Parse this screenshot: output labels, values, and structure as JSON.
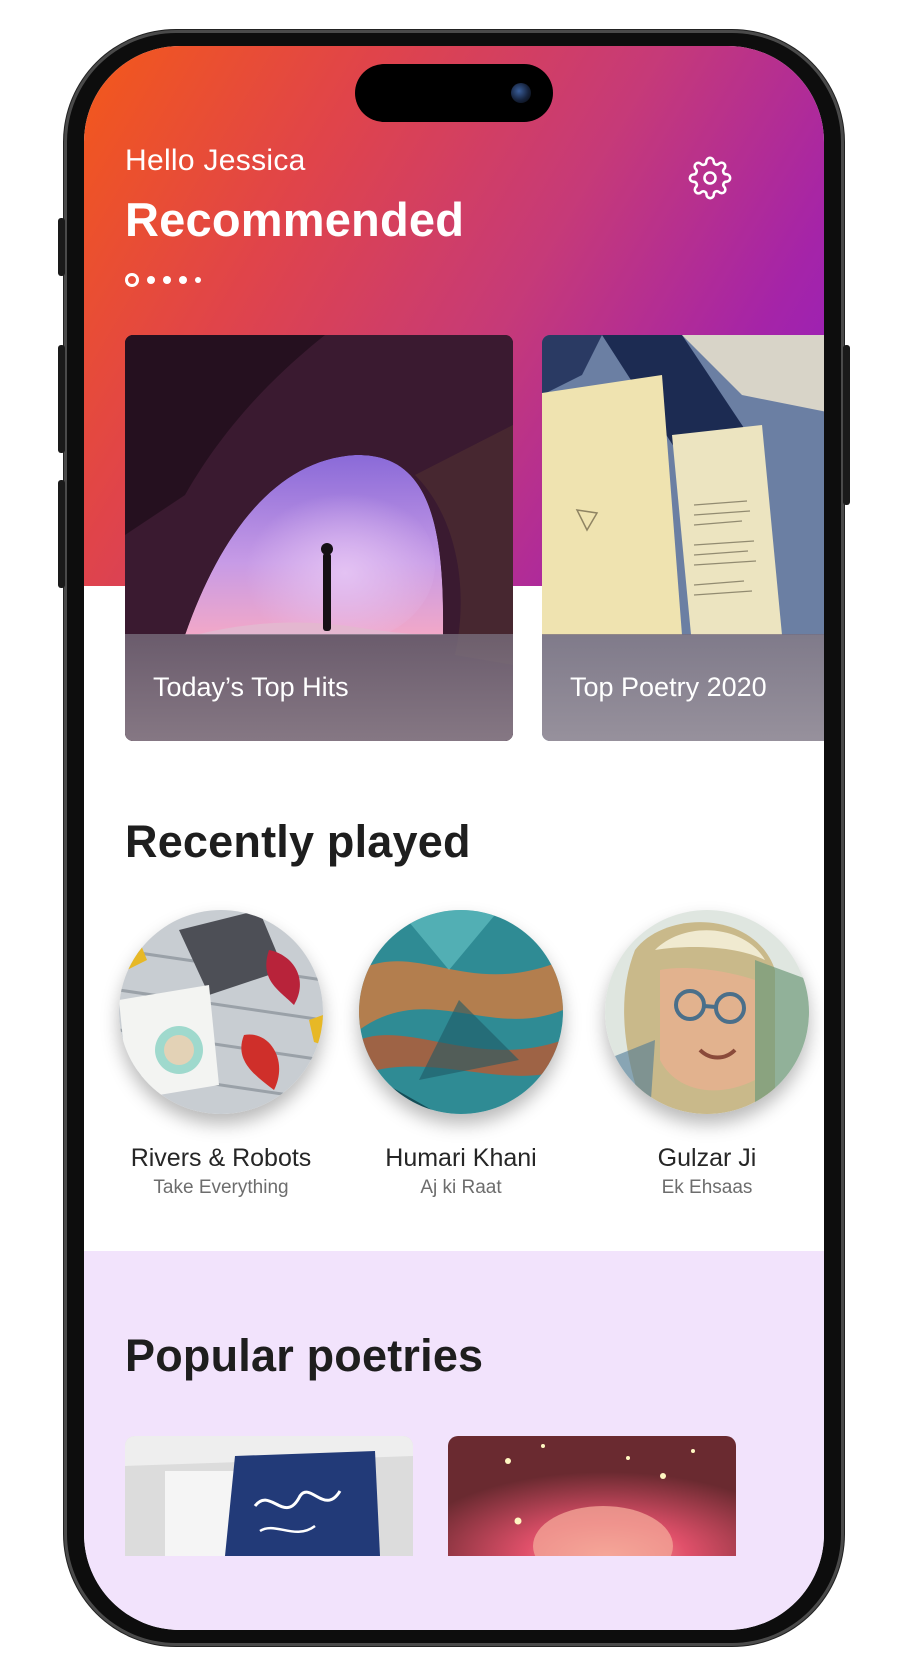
{
  "header": {
    "greeting": "Hello Jessica",
    "title": "Recommended"
  },
  "carousel": {
    "active_index": 0,
    "dot_count": 5,
    "cards": [
      {
        "title": "Today’s Top Hits"
      },
      {
        "title": "Top Poetry 2020"
      }
    ]
  },
  "recently_played": {
    "title": "Recently played",
    "items": [
      {
        "name": "Rivers & Robots",
        "subtitle": "Take Everything"
      },
      {
        "name": "Humari Khani",
        "subtitle": "Aj ki Raat"
      },
      {
        "name": "Gulzar Ji",
        "subtitle": "Ek Ehsaas"
      }
    ]
  },
  "popular": {
    "title": "Popular poetries"
  },
  "icons": {
    "settings": "gear-icon"
  },
  "colors": {
    "gradient_start": "#f3591a",
    "gradient_end": "#8e1ec6",
    "popular_bg": "#f2e3fc"
  }
}
